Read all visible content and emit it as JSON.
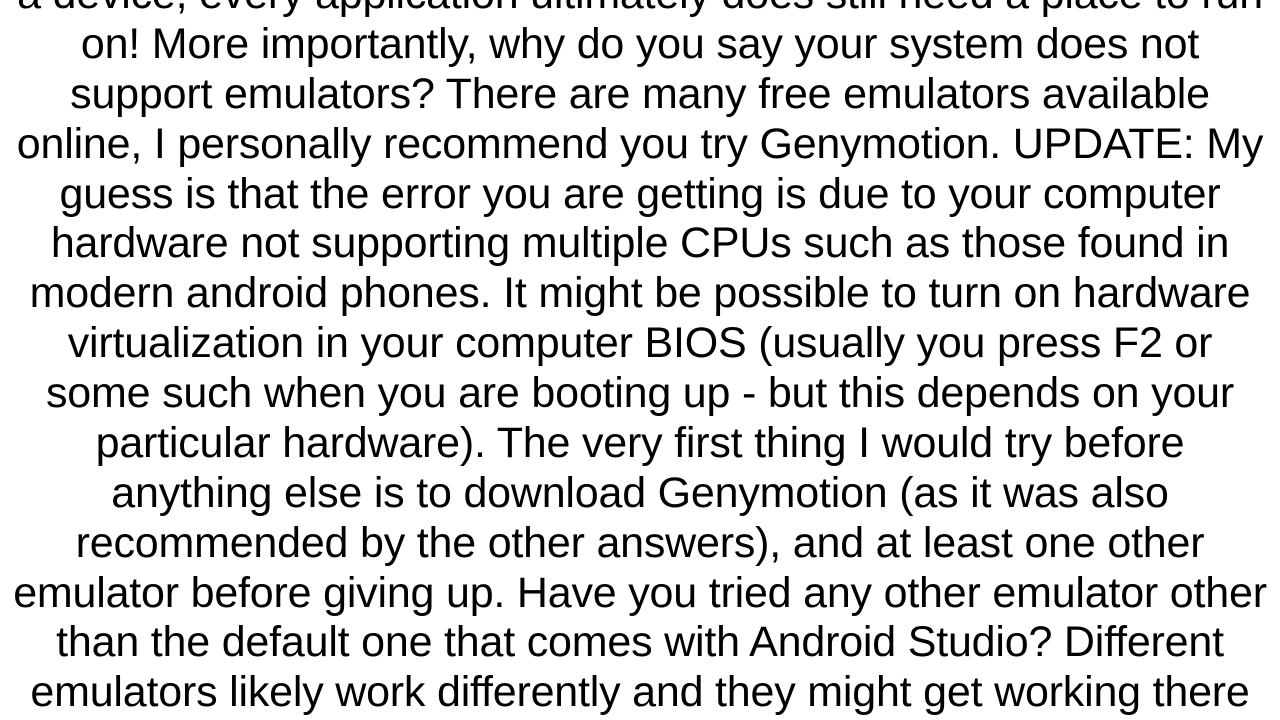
{
  "body_text": "a device, every application ultimately does still need a place to run on! More importantly, why do you say your system does not support emulators?  There are many free emulators available online, I personally recommend you try Genymotion. UPDATE:  My guess is that the error you are getting is due to your computer hardware not supporting multiple CPUs such as those found in modern android phones.  It might be possible to turn on hardware virtualization in your computer BIOS (usually you press F2 or some such when you are booting up - but this depends on your particular hardware). The very first thing I would try before anything else is to download Genymotion (as it was also recommended by the other answers), and at least one other emulator before giving up. Have you tried any other emulator other than the default one that comes with Android Studio?  Different emulators likely work differently and they might get working there"
}
